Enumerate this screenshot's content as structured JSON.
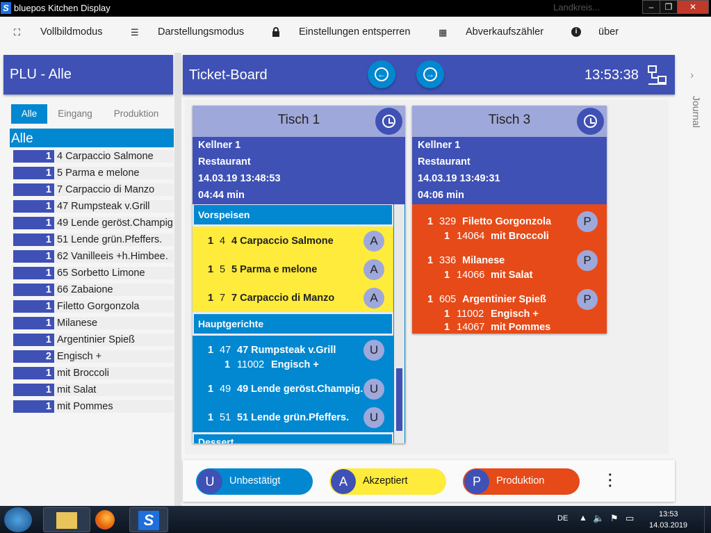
{
  "window": {
    "title": "bluepos Kitchen Display",
    "ghost": "Landkreis..."
  },
  "menu": [
    {
      "icon": "fullscreen-icon",
      "glyph": "⛶",
      "label": "Vollbildmodus"
    },
    {
      "icon": "list-icon",
      "glyph": "☰",
      "label": "Darstellungsmodus"
    },
    {
      "icon": "lock-icon",
      "glyph": "🔒",
      "label": "Einstellungen entsperren"
    },
    {
      "icon": "counter-icon",
      "glyph": "▦",
      "label": "Abverkaufszähler"
    },
    {
      "icon": "info-icon",
      "glyph": "ℹ",
      "label": "über"
    }
  ],
  "plu": {
    "title": "PLU - Alle",
    "tabs": [
      "Alle",
      "Eingang",
      "Produktion"
    ],
    "group": "Alle",
    "items": [
      {
        "qty": "1",
        "name": "4 Carpaccio Salmone"
      },
      {
        "qty": "1",
        "name": "5 Parma e melone"
      },
      {
        "qty": "1",
        "name": "7 Carpaccio di Manzo"
      },
      {
        "qty": "1",
        "name": "47 Rumpsteak v.Grill"
      },
      {
        "qty": "1",
        "name": "49 Lende geröst.Champig"
      },
      {
        "qty": "1",
        "name": "51 Lende grün.Pfeffers."
      },
      {
        "qty": "1",
        "name": "62 Vanilleeis +h.Himbee."
      },
      {
        "qty": "1",
        "name": "65 Sorbetto Limone"
      },
      {
        "qty": "1",
        "name": "66 Zabaione"
      },
      {
        "qty": "1",
        "name": "Filetto Gorgonzola"
      },
      {
        "qty": "1",
        "name": "Milanese"
      },
      {
        "qty": "1",
        "name": "Argentinier Spieß"
      },
      {
        "qty": "2",
        "name": "Engisch +"
      },
      {
        "qty": "1",
        "name": "mit Broccoli"
      },
      {
        "qty": "1",
        "name": "mit Salat"
      },
      {
        "qty": "1",
        "name": "mit Pommes"
      }
    ]
  },
  "board": {
    "title": "Ticket-Board",
    "clock": "13:53:38",
    "prev_icon": "arrow-left-circle-icon",
    "next_icon": "arrow-right-circle-icon"
  },
  "tickets": [
    {
      "table": "Tisch 1",
      "waiter": "Kellner 1",
      "area": "Restaurant",
      "time": "14.03.19 13:48:53",
      "elapsed": "04:44 min",
      "sections": [
        {
          "name": "Vorspeisen",
          "items": [
            {
              "qty": "1",
              "plu": "4",
              "name": "4 Carpaccio Salmone",
              "badge": "A"
            },
            {
              "qty": "1",
              "plu": "5",
              "name": "5 Parma e melone",
              "badge": "A"
            },
            {
              "qty": "1",
              "plu": "7",
              "name": "7 Carpaccio di Manzo",
              "badge": "A"
            }
          ]
        },
        {
          "name": "Hauptgerichte",
          "items": [
            {
              "qty": "1",
              "plu": "47",
              "name": "47 Rumpsteak v.Grill",
              "badge": "U",
              "sub": {
                "qty": "1",
                "plu": "11002",
                "name": "Engisch +"
              }
            },
            {
              "qty": "1",
              "plu": "49",
              "name": "49 Lende geröst.Champig.",
              "badge": "U"
            },
            {
              "qty": "1",
              "plu": "51",
              "name": "51 Lende grün.Pfeffers.",
              "badge": "U"
            }
          ]
        },
        {
          "name": "Dessert"
        }
      ]
    },
    {
      "table": "Tisch 3",
      "waiter": "Kellner 1",
      "area": "Restaurant",
      "time": "14.03.19 13:49:31",
      "elapsed": "04:06 min",
      "items": [
        {
          "qty": "1",
          "plu": "329",
          "name": "Filetto Gorgonzola",
          "badge": "P",
          "sub": {
            "qty": "1",
            "plu": "14064",
            "name": "mit Broccoli"
          }
        },
        {
          "qty": "1",
          "plu": "336",
          "name": "Milanese",
          "badge": "P",
          "sub": {
            "qty": "1",
            "plu": "14066",
            "name": "mit Salat"
          }
        },
        {
          "qty": "1",
          "plu": "605",
          "name": "Argentinier Spieß",
          "badge": "P",
          "sub": {
            "qty": "1",
            "plu": "11002",
            "name": "Engisch +"
          },
          "sub2": {
            "qty": "1",
            "plu": "14067",
            "name": "mit Pommes"
          }
        }
      ]
    }
  ],
  "legend": [
    {
      "key": "U",
      "label": "Unbestätigt",
      "color": "#0288d1"
    },
    {
      "key": "A",
      "label": "Akzeptiert",
      "color": "#ffeb3b"
    },
    {
      "key": "P",
      "label": "Produktion",
      "color": "#e64a19"
    }
  ],
  "side": {
    "journal": "Journal"
  },
  "taskbar": {
    "lang": "DE",
    "time": "13:53",
    "date": "14.03.2019"
  },
  "colors": {
    "primary": "#3f51b5",
    "accent": "#0288d1",
    "accepted": "#ffeb3b",
    "production": "#e64a19",
    "header_light": "#9fa8da"
  }
}
